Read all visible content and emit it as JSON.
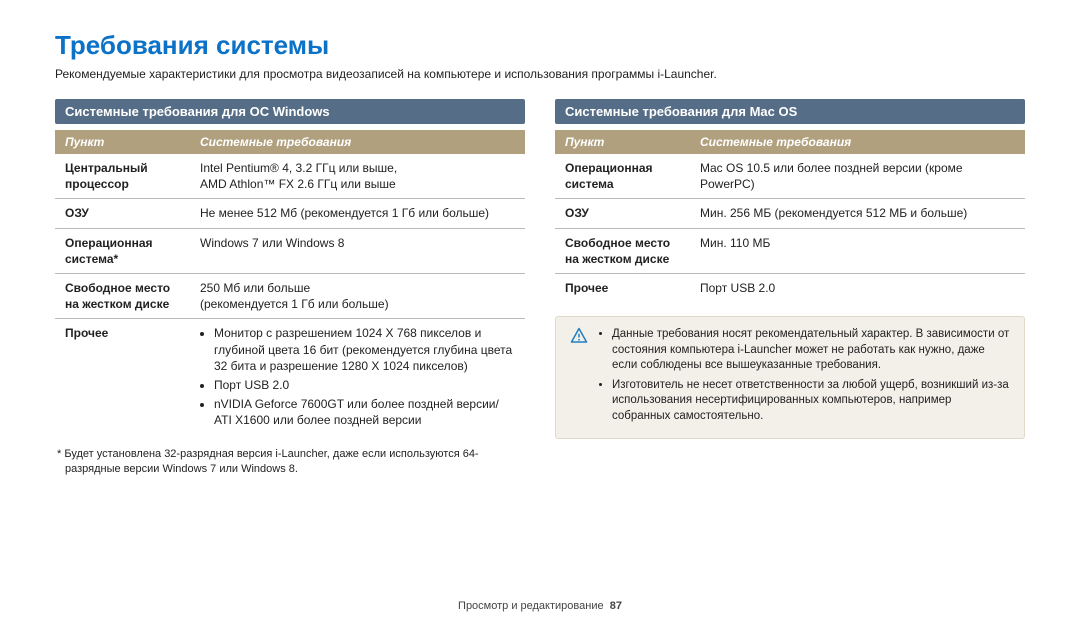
{
  "title": "Требования системы",
  "subtitle": "Рекомендуемые характеристики для просмотра видеозаписей на компьютере и использования программы i-Launcher.",
  "windows": {
    "heading": "Системные требования для ОС Windows",
    "col1": "Пункт",
    "col2": "Системные требования",
    "rows": {
      "cpu_label": "Центральный процессор",
      "cpu_value": "Intel Pentium® 4, 3.2 ГГц или выше,\nAMD Athlon™ FX 2.6 ГГц или выше",
      "ram_label": "ОЗУ",
      "ram_value": "Не менее 512 Мб (рекомендуется 1 Гб или больше)",
      "os_label": "Операционная система*",
      "os_value": "Windows 7 или Windows 8",
      "hdd_label": "Свободное место на жестком диске",
      "hdd_value": "250 Мб или больше\n(рекомендуется 1 Гб или больше)",
      "other_label": "Прочее",
      "other_b1": "Монитор с разрешением 1024 X 768 пикселов и глубиной цвета 16 бит (рекомендуется глубина цвета 32 бита и разрешение 1280 X 1024 пикселов)",
      "other_b2": "Порт USB 2.0",
      "other_b3": "nVIDIA Geforce 7600GT или более поздней версии/ ATI X1600 или более поздней версии"
    },
    "footnote": "*  Будет установлена 32-разрядная версия i-Launcher, даже если используются 64-разрядные версии Windows 7 или Windows 8."
  },
  "mac": {
    "heading": "Системные требования для Mac OS",
    "col1": "Пункт",
    "col2": "Системные требования",
    "rows": {
      "os_label": "Операционная система",
      "os_value": "Mac OS 10.5 или более поздней версии (кроме PowerPC)",
      "ram_label": "ОЗУ",
      "ram_value": "Мин. 256 МБ (рекомендуется 512 МБ и больше)",
      "hdd_label": "Свободное место на жестком диске",
      "hdd_value": "Мин. 110 МБ",
      "other_label": "Прочее",
      "other_value": "Порт USB 2.0"
    }
  },
  "notice": {
    "b1": "Данные требования носят рекомендательный характер. В зависимости от состояния компьютера i-Launcher может не работать как нужно, даже если соблюдены все вышеуказанные требования.",
    "b2": "Изготовитель не несет ответственности за любой ущерб, возникший из-за использования несертифицированных компьютеров, например собранных самостоятельно."
  },
  "footer": {
    "section": "Просмотр и редактирование",
    "page": "87"
  }
}
